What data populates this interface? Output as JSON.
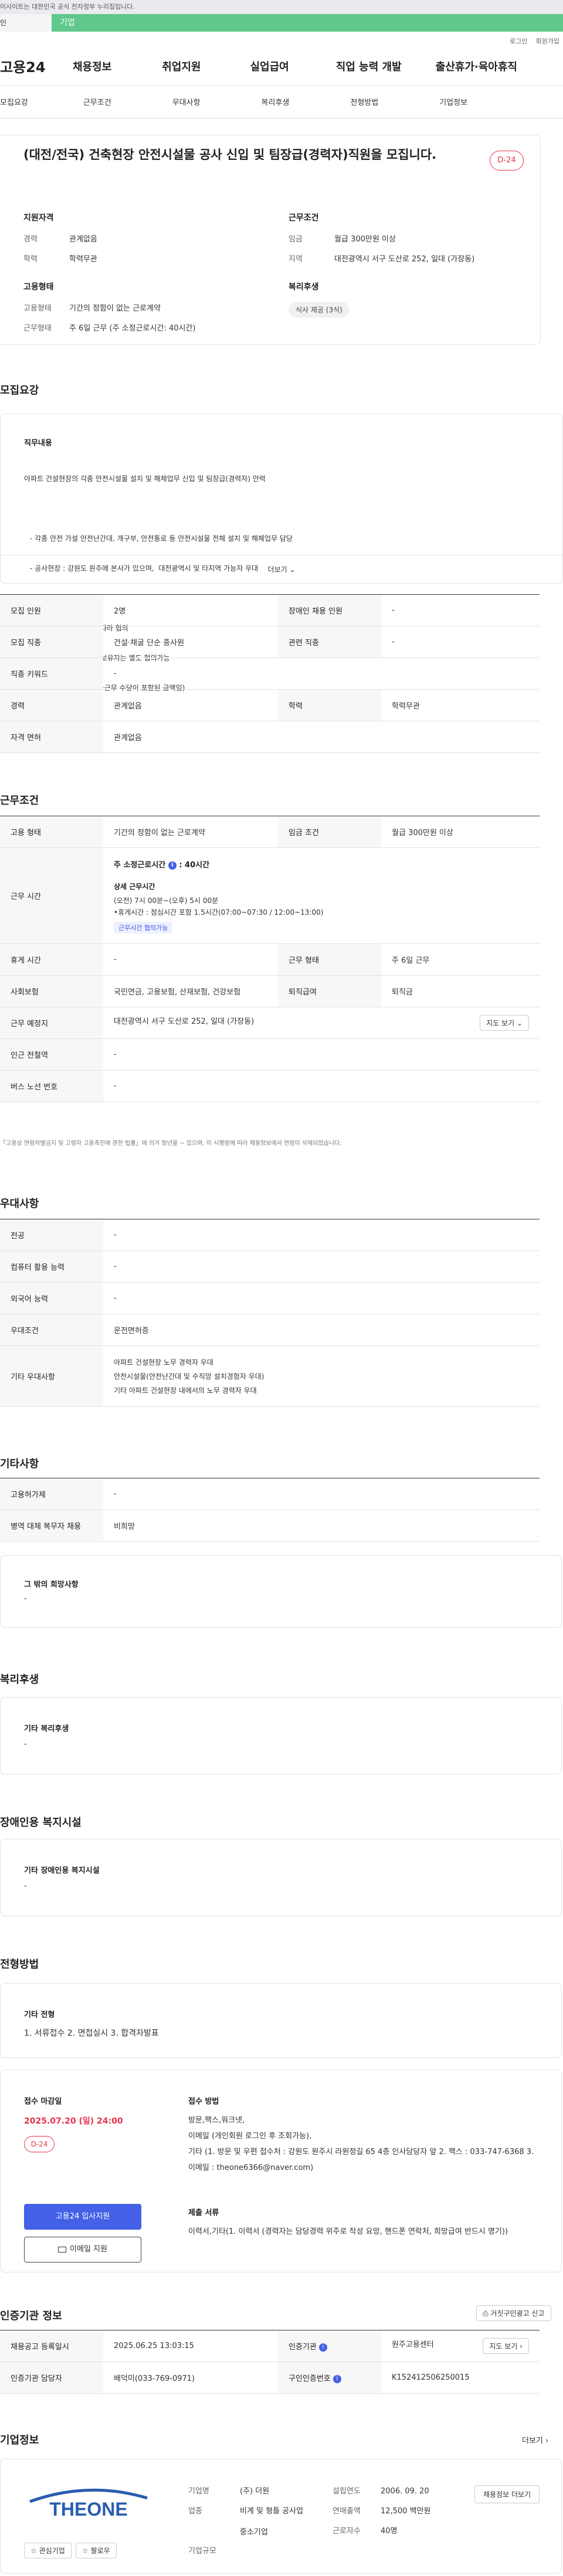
{
  "gov_banner": "이사이트는 대한민국 공식 전자정부 누리집입니다.",
  "notice": {
    "left": "인",
    "bar": "기업"
  },
  "util": [
    "로그인",
    "회원가입"
  ],
  "gnb": {
    "logo": "고용24",
    "items": [
      "채용정보",
      "취업지원",
      "실업급여",
      "직업 능력 개발",
      "출산휴가·육아휴직"
    ]
  },
  "subnav": [
    "모집요강",
    "근무조건",
    "우대사항",
    "복리후생",
    "전형방법",
    "기업정보"
  ],
  "header": {
    "title": "(대전/전국) 건축현장 안전시설물 공사 신입 및 팀장급(경력자)직원을 모집니다.",
    "dday": "D-24",
    "qual_title": "지원자격",
    "qual": [
      {
        "k": "경력",
        "v": "관계없음"
      },
      {
        "k": "학력",
        "v": "학력무관"
      }
    ],
    "cond_title": "근무조건",
    "cond": [
      {
        "k": "임금",
        "v": "월급 300만원 이상"
      },
      {
        "k": "지역",
        "v": "대전광역시 서구 도산로 252, 일대 (가장동)"
      }
    ],
    "emp_title": "고용형태",
    "emp": [
      {
        "k": "고용형태",
        "v": "기간의 정함이 없는 근로계약"
      },
      {
        "k": "근무형태",
        "v": "주 6일 근무 (주 소정근로시간: 40시간)"
      }
    ],
    "welfare_title": "복리후생",
    "welfare_chip": "식사 제공 (3식)"
  },
  "recruit": {
    "title": "모집요강",
    "duty_title": "직무내용",
    "duty_lines": [
      "아파트 건설현장의 각종 안전시설물 설치 및 해체업무 신입 및 팀장급(경력자) 안력",
      "",
      "- 각종 안전 가설 안전난간대, 개구부, 안전통로 등 안전시설물 전체 설치 및 해체업무 담당",
      "- 공사현장 : 강원도 원주에 본사가 있으며,  대전광역시 및 타지역 가능자 우대",
      "",
      "급여기준 : 면접시 경력에 따라 협의",
      "            안전시설물 경력 보유자는 별도 협의가능",
      "(*급여에 주40시간 외 초과근무 수당이 포함된 금액임)"
    ],
    "more": "더보기 ⌄",
    "rows": [
      {
        "k1": "모집 인원",
        "v1": "2명",
        "k2": "장애인 채용 인원",
        "v2": "-"
      },
      {
        "k1": "모집 직종",
        "v1": "건설·채굴 단순 종사원",
        "k2": "관련 직종",
        "v2": "-"
      },
      {
        "k1": "직종 키워드",
        "v1": "-"
      },
      {
        "k1": "경력",
        "v1": "관계없음",
        "k2": "학력",
        "v2": "학력무관"
      },
      {
        "k1": "자격 면허",
        "v1": "관계없음"
      }
    ]
  },
  "work": {
    "title": "근무조건",
    "r1": {
      "k1": "고용 형태",
      "v1": "기간의 정함이 없는 근로계약",
      "k2": "임금 조건",
      "v2": "월급 300만원 이상"
    },
    "hours_k": "근무 시간",
    "hours_main": "주 소정근로시간",
    "hours_val": ": 40시간",
    "hours_detail_title": "상세 근무시간",
    "hours_detail": "(오전) 7시 00분~(오후) 5시 00분",
    "hours_break": "•휴게시간 : 점심시간 포함 1.5시간(07:00~07:30 / 12:00~13:00)",
    "hours_chip": "근무시간 협의가능",
    "r3": {
      "k1": "휴게 시간",
      "v1": "-",
      "k2": "근무 형태",
      "v2": "주 6일 근무"
    },
    "r4": {
      "k1": "사회보험",
      "v1": "국민연금, 고용보험, 산재보험, 건강보험",
      "k2": "퇴직급여",
      "v2": "퇴직금"
    },
    "r5": {
      "k1": "근무 예정지",
      "v1": "대전광역시 서구 도산로 252, 일대 (가장동)",
      "btn": "지도 보기 ⌄"
    },
    "r6": {
      "k1": "인근 전철역",
      "v1": "-"
    },
    "r7": {
      "k1": "버스 노선 번호",
      "v1": "-"
    },
    "note": "「고용상 연령차별금지 및 고령자 고용촉진에 관한 법률」에 의거 정년을 ~ 있으며, 이 시행령에 따라 채용정보에서 연령이 삭제되었습니다."
  },
  "pref": {
    "title": "우대사항",
    "rows": [
      {
        "k": "전공",
        "v": "-"
      },
      {
        "k": "컴퓨터 활용 능력",
        "v": "-"
      },
      {
        "k": "외국어 능력",
        "v": "-"
      },
      {
        "k": "우대조건",
        "v": "운전면허증"
      },
      {
        "k": "기타 우대사항",
        "lines": [
          "아파트 건설현장 노무 경력자 우대",
          "안전시설물(안전난간대 및 수직망 설치경험자 우대)",
          "기타 아파트 건설현장 내에서의 노무 경력자 우대"
        ]
      }
    ]
  },
  "etc": {
    "title": "기타사항",
    "rows": [
      {
        "k": "고용허가제",
        "v": "-"
      },
      {
        "k": "병역 대체 복무자 채용",
        "v": "비희망"
      }
    ],
    "box_title": "그 밖의 희망사항",
    "box_val": "-"
  },
  "welfare": {
    "title": "복리후생",
    "box_title": "기타 복리후생",
    "box_val": "-"
  },
  "disabled": {
    "title": "장애인용 복지시설",
    "box_title": "기타 장애인용 복지시설",
    "box_val": "-"
  },
  "select": {
    "title": "전형방법",
    "box_title": "기타 전형",
    "box_val": "1. 서류접수 2. 면접실시 3. 합격자발표",
    "deadline_label": "접수 마감일",
    "deadline": "2025.07.20 (일) 24:00",
    "dday": "D-24",
    "apply_btn": "고용24 입사지원",
    "email_btn": "이메일 지원",
    "method_label": "접수 방법",
    "method_lines": [
      "방문,팩스,워크넷,",
      "이메일 (개인회원 로그인 후 조회가능),",
      "기타 (1. 방문 및 우편 접수처 : 강원도 원주시 라원정길 65 4층 인사담당자 앞 2. 팩스 : 033-747-6368 3. 이메일 : theone6366@naver.com)"
    ],
    "docs_label": "제출 서류",
    "docs_lines": [
      "이력서,기타(1. 이력서     (경력자는 담당경력 위주로 작성 요망, 핸드폰 연락처, 희망급여 반드시 명기))"
    ]
  },
  "agency": {
    "title": "인증기관 정보",
    "btn": "거짓구인광고 신고",
    "r1": {
      "k1": "채용공고 등록일시",
      "v1": "2025.06.25 13:03:15",
      "k2": "인증기관",
      "v2": "원주고용센터",
      "btn": "지도 보기 ›"
    },
    "r2": {
      "k1": "인증기관 담당자",
      "v1": "배덕미(033-769-0971)",
      "k2": "구인인증번호",
      "v2": "K152412506250015"
    }
  },
  "company": {
    "title": "기업정보",
    "more": "더보기 ›",
    "logo_text": "THEONE",
    "btn_fav": "관심기업",
    "btn_follow": "팔로우",
    "name_k": "기업명",
    "name_v": "(주) 더원",
    "est_k": "설립연도",
    "est_v": "2006. 09. 20",
    "ind_k": "업종",
    "ind_v": "비계 및 형틀 공사업",
    "sales_k": "연매출액",
    "sales_v": "12,500 백만원",
    "emp_k": "근로자수",
    "emp_v": "40명",
    "size_k": "기업규모",
    "size_v": "중소기업",
    "recruit_btn": "채용정보 더보기"
  }
}
